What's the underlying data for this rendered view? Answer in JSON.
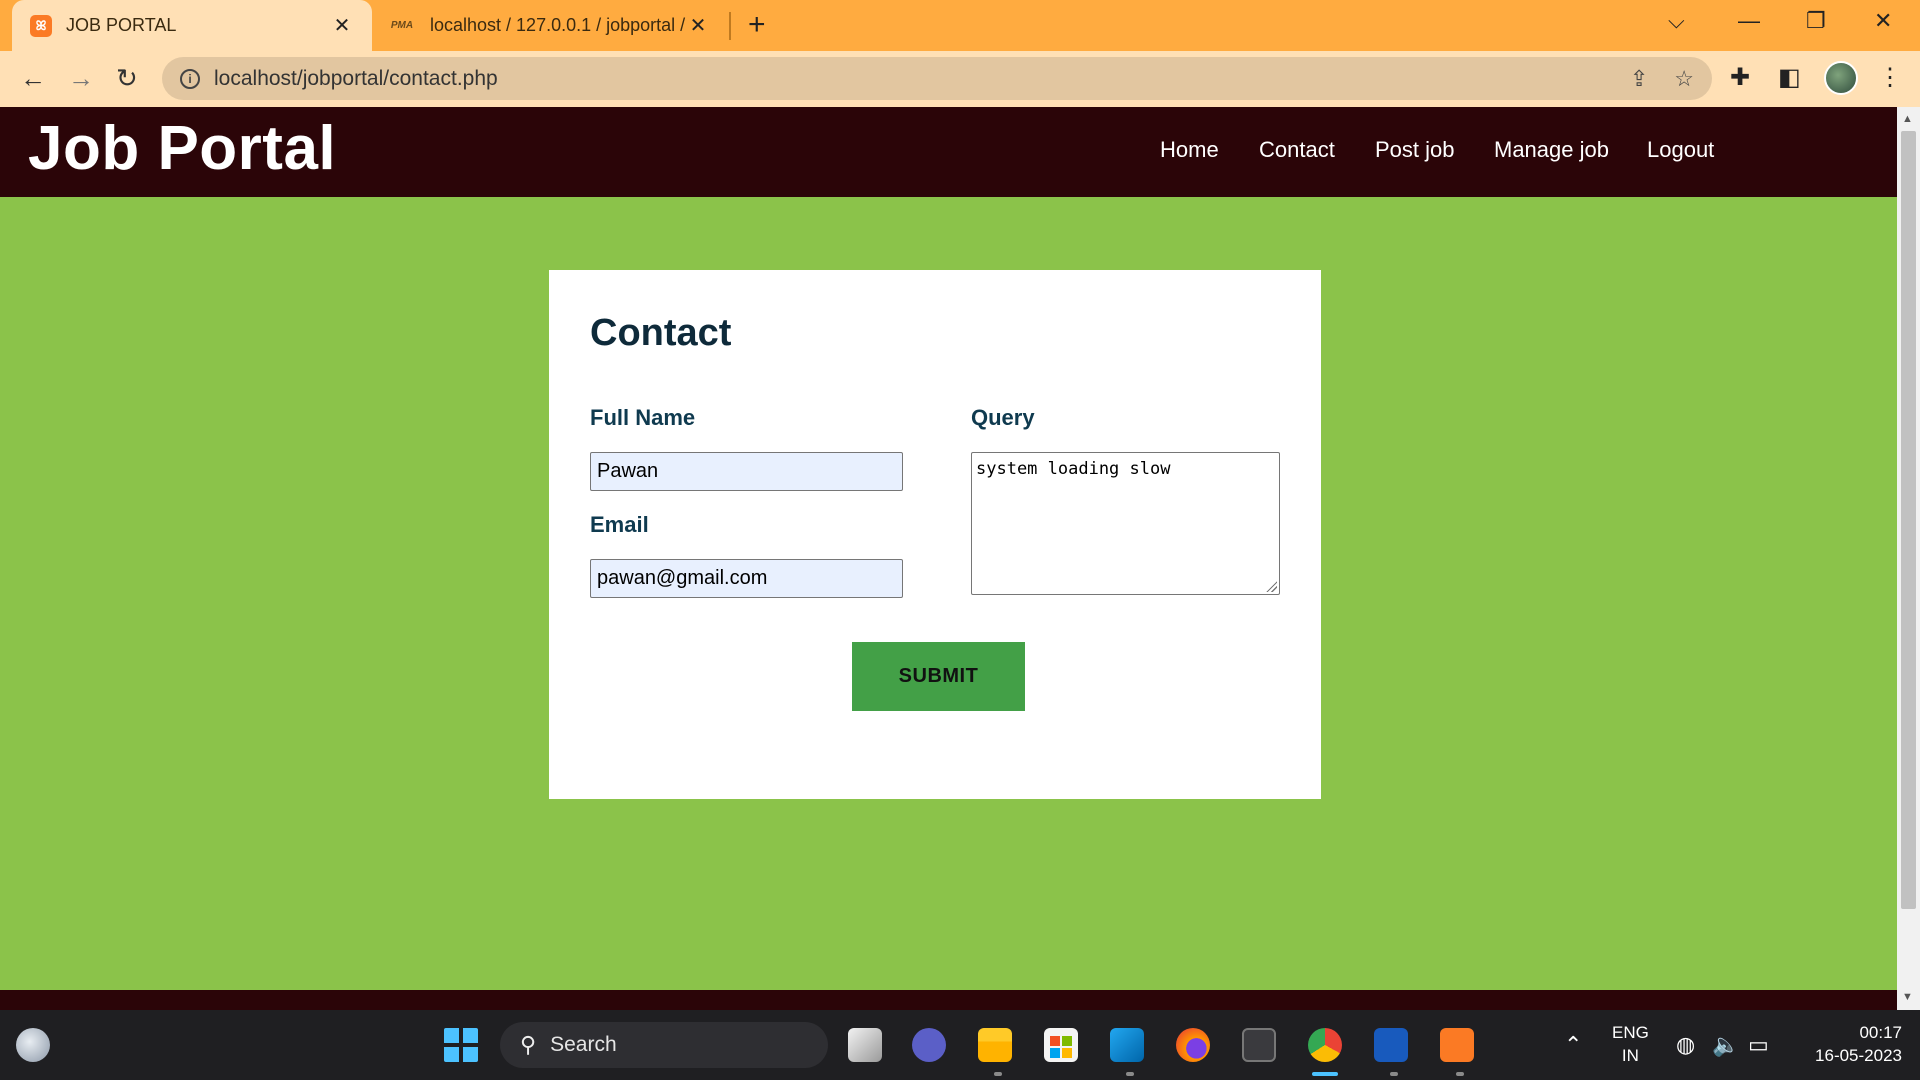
{
  "browser": {
    "tabs": [
      {
        "title": "JOB PORTAL",
        "favicon": "xampp-icon",
        "active": true
      },
      {
        "title": "localhost / 127.0.0.1 / jobportal /",
        "favicon": "phpmyadmin-icon",
        "active": false
      }
    ],
    "favicon_pma_text": "PMA",
    "url": "localhost/jobportal/contact.php"
  },
  "site": {
    "logo": "Job Portal",
    "nav": [
      "Home",
      "Contact",
      "Post job",
      "Manage job",
      "Logout"
    ]
  },
  "form": {
    "title": "Contact",
    "full_name_label": "Full Name",
    "full_name_value": "Pawan",
    "email_label": "Email",
    "email_value": "pawan@gmail.com",
    "query_label": "Query",
    "query_value": "system loading slow",
    "submit_label": "SUBMIT"
  },
  "taskbar": {
    "search_placeholder": "Search",
    "lang_line1": "ENG",
    "lang_line2": "IN",
    "time": "00:17",
    "date": "16-05-2023"
  },
  "colors": {
    "page_bg": "#8bc34a",
    "header_bg": "#2b0508",
    "submit_bg": "#43a047",
    "tabbar_bg": "#ffab40"
  }
}
